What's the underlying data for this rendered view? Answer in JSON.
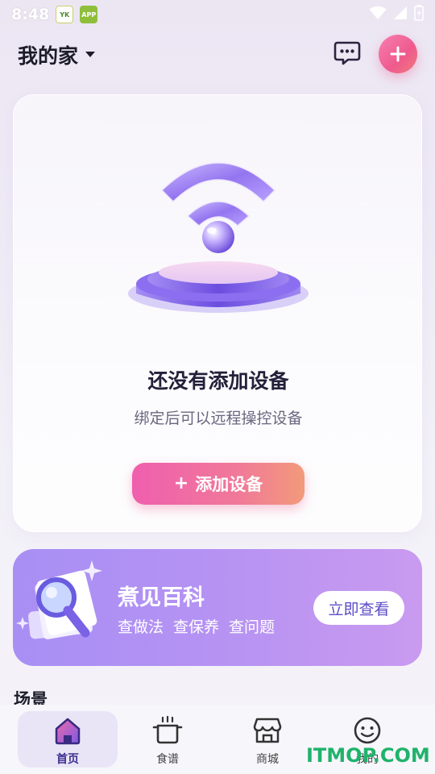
{
  "status_bar": {
    "time": "8:48",
    "app_icon_1": "YK",
    "app_icon_2": "APP"
  },
  "header": {
    "home_name": "我的家"
  },
  "empty_state": {
    "title": "还没有添加设备",
    "subtitle": "绑定后可以远程操控设备",
    "add_button_plus": "+",
    "add_button_label": "添加设备"
  },
  "encyclopedia": {
    "title": "煮见百科",
    "tags": [
      "查做法",
      "查保养",
      "查问题"
    ],
    "button_label": "立即查看"
  },
  "scenes": {
    "heading": "场景"
  },
  "tabs": [
    {
      "label": "首页",
      "icon": "home-icon",
      "active": true
    },
    {
      "label": "食谱",
      "icon": "pot-icon",
      "active": false
    },
    {
      "label": "商城",
      "icon": "store-icon",
      "active": false
    },
    {
      "label": "我的",
      "icon": "smiley-icon",
      "active": false
    }
  ],
  "watermark": "ITMOP.COM",
  "colors": {
    "accent_pink": "#ef5fae",
    "accent_purple": "#7b5ae6",
    "banner_purple": "#a88ff4"
  }
}
